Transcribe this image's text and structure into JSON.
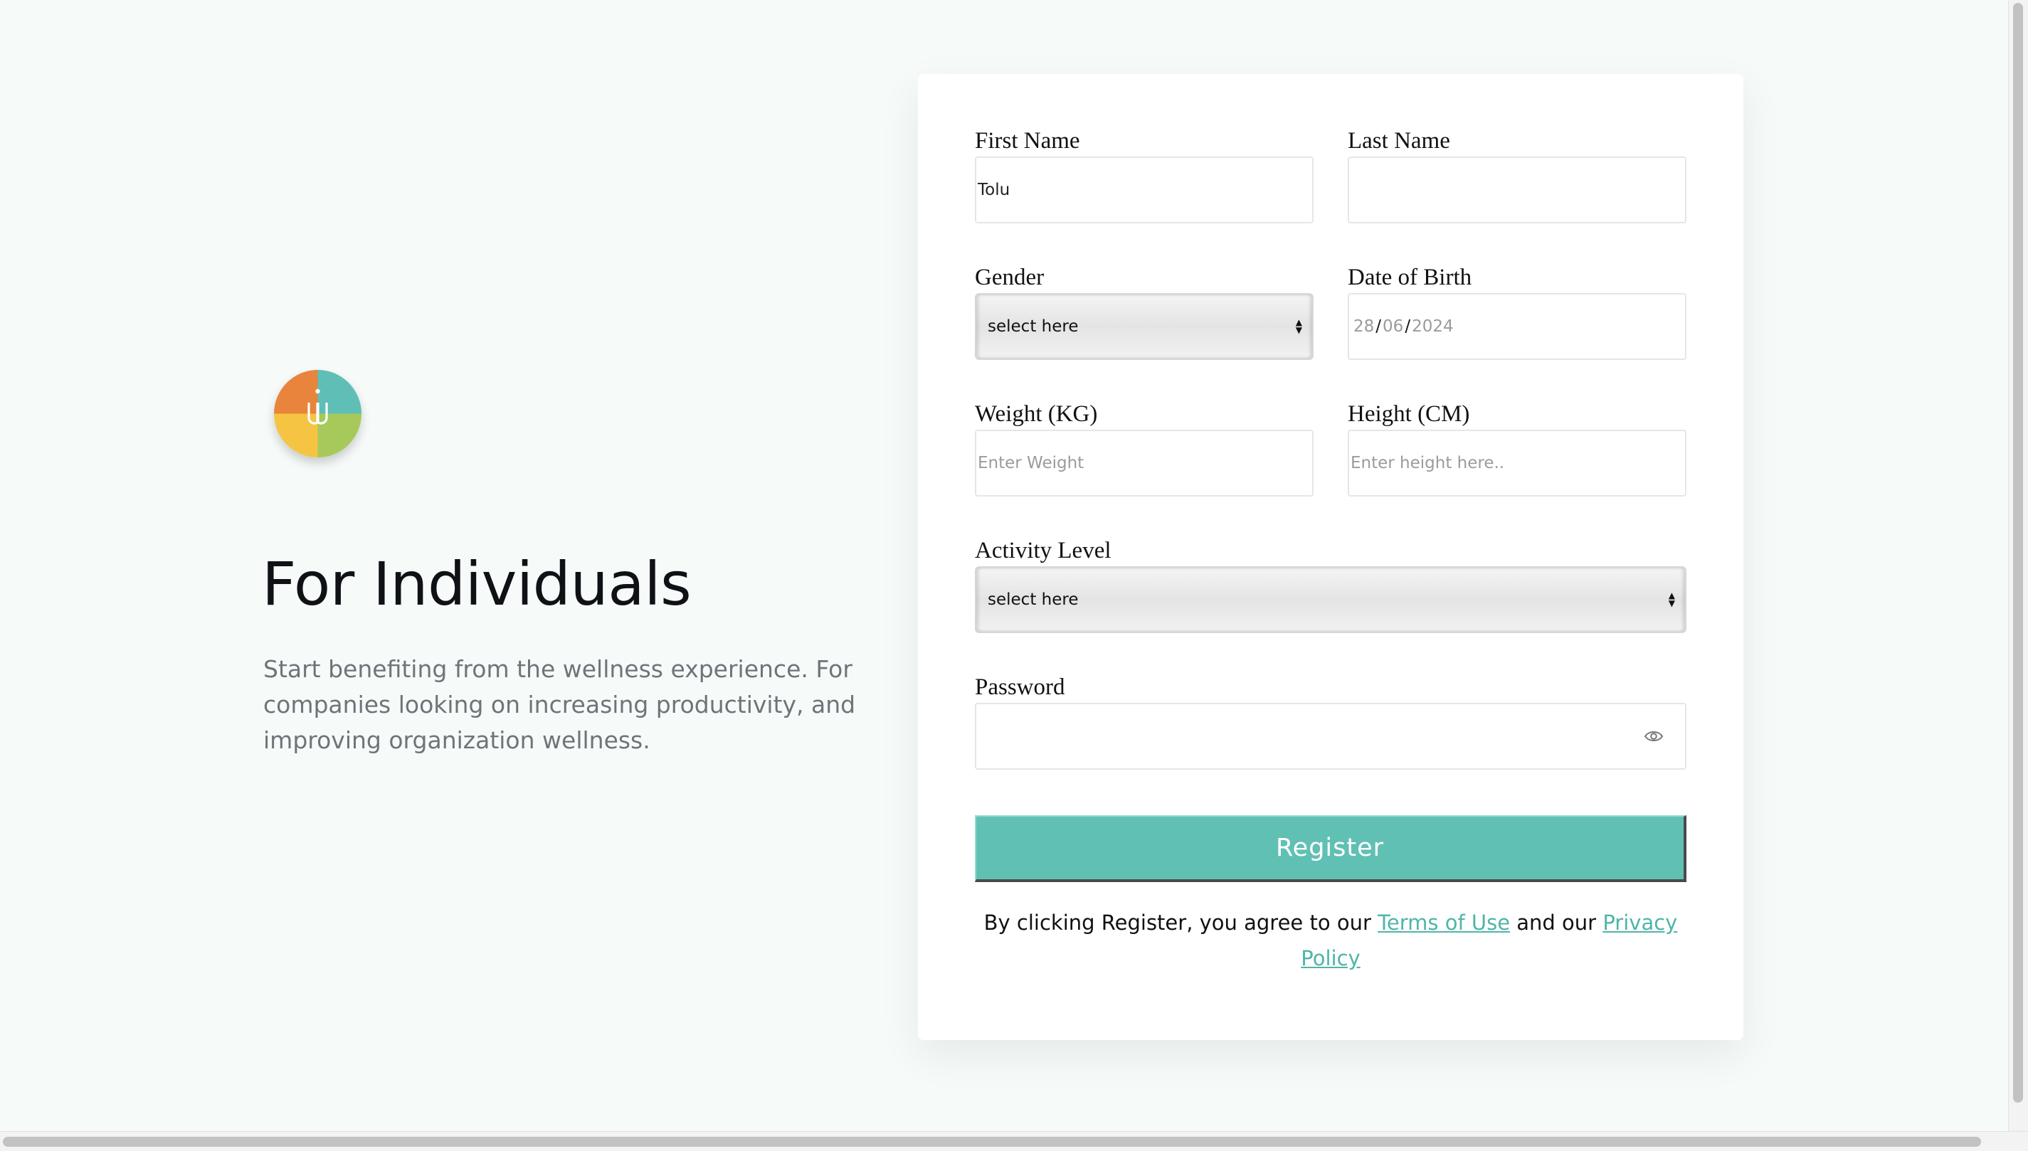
{
  "hero": {
    "logo_icon": "wellness-logo-icon",
    "title": "For Individuals",
    "description": "Start benefiting from the wellness experience. For companies looking on increasing productivity, and improving organization wellness."
  },
  "form": {
    "first_name": {
      "label": "First Name",
      "value": "Tolu"
    },
    "last_name": {
      "label": "Last Name",
      "value": ""
    },
    "gender": {
      "label": "Gender",
      "selected": "select here"
    },
    "dob": {
      "label": "Date of Birth",
      "day": "28",
      "month": "06",
      "year": "2024",
      "separator": "/"
    },
    "weight": {
      "label": "Weight (KG)",
      "placeholder": "Enter Weight"
    },
    "height": {
      "label": "Height (CM)",
      "placeholder": "Enter height here.."
    },
    "activity_level": {
      "label": "Activity Level",
      "selected": "select here"
    },
    "password": {
      "label": "Password",
      "value": "",
      "toggle_icon": "eye-icon"
    },
    "register_label": "Register",
    "terms": {
      "prefix": "By clicking Register, you agree to our",
      "terms_link": "Terms of Use",
      "middle": "and our",
      "privacy_link": "Privacy Policy"
    }
  },
  "colors": {
    "accent": "#61c0b4",
    "link": "#4fb5a8",
    "page_bg": "#f6faf9",
    "card_bg": "#ffffff",
    "logo_orange": "#e8843b",
    "logo_teal": "#5fbfb6",
    "logo_yellow": "#f5c443",
    "logo_green": "#a6c95a"
  }
}
